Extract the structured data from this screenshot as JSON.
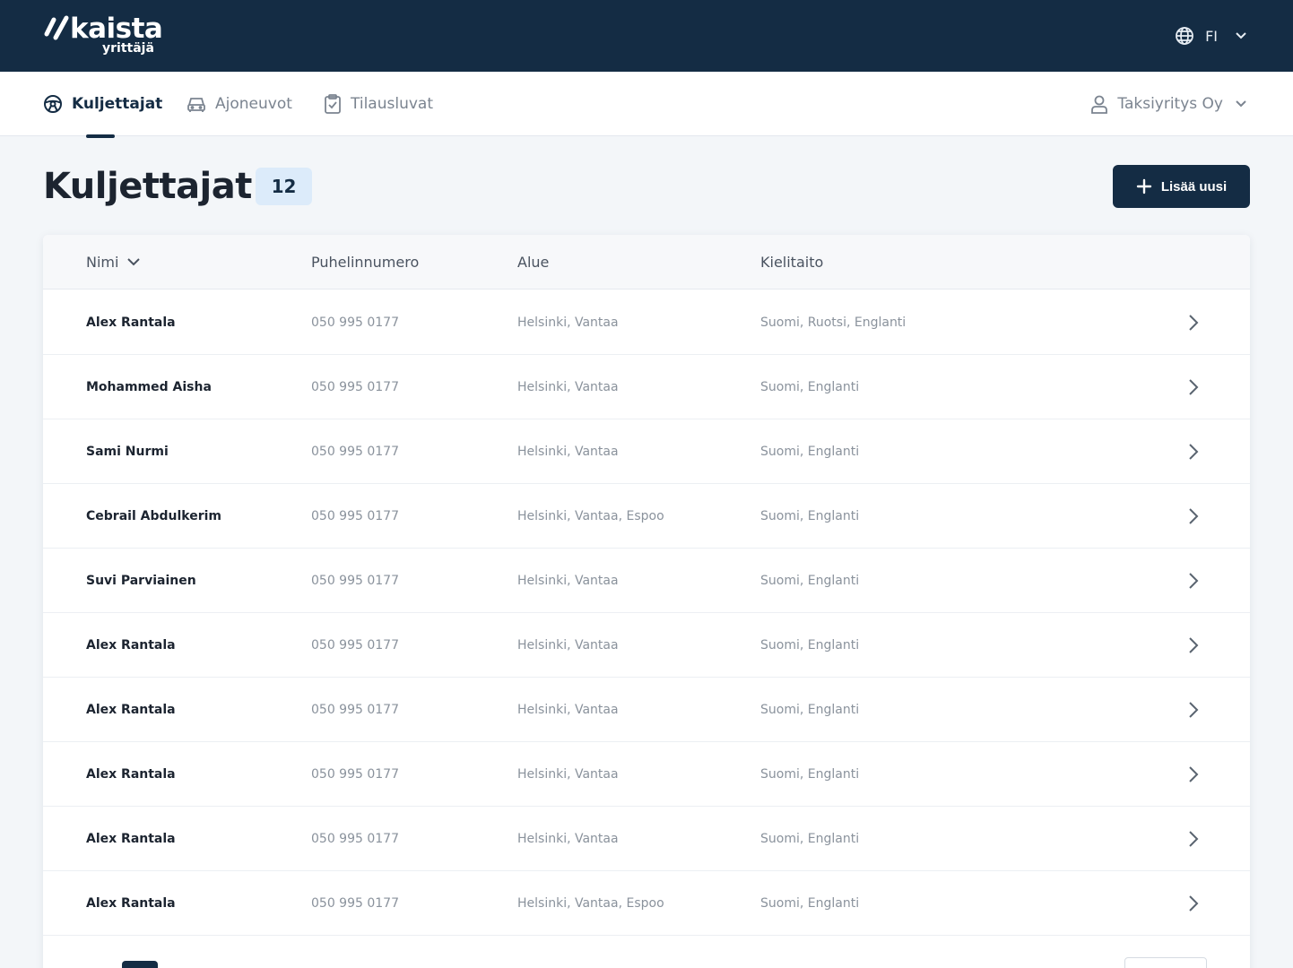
{
  "app": {
    "logo_main": "kaista",
    "logo_sub": "yrittäjä",
    "brand_color": "#142c44"
  },
  "language": {
    "label": "FI",
    "icon": "globe-icon"
  },
  "nav": {
    "items": [
      {
        "label": "Kuljettajat",
        "icon": "steering-wheel-icon",
        "active": true
      },
      {
        "label": "Ajoneuvot",
        "icon": "car-icon",
        "active": false
      },
      {
        "label": "Tilausluvat",
        "icon": "clipboard-icon",
        "active": false
      }
    ],
    "company": {
      "label": "Taksiyritys Oy",
      "icon": "user-icon"
    }
  },
  "page": {
    "title": "Kuljettajat",
    "count": "12",
    "add_button_label": "Lisää uusi"
  },
  "table": {
    "columns": [
      "Nimi",
      "Puhelinnumero",
      "Alue",
      "Kielitaito"
    ],
    "rows": [
      {
        "name": "Alex Rantala",
        "phone": "050 995 0177",
        "area": "Helsinki, Vantaa",
        "languages": "Suomi, Ruotsi, Englanti"
      },
      {
        "name": "Mohammed Aisha",
        "phone": "050 995 0177",
        "area": "Helsinki, Vantaa",
        "languages": "Suomi, Englanti"
      },
      {
        "name": "Sami Nurmi",
        "phone": "050 995 0177",
        "area": "Helsinki, Vantaa",
        "languages": "Suomi, Englanti"
      },
      {
        "name": "Cebrail Abdulkerim",
        "phone": "050 995 0177",
        "area": "Helsinki, Vantaa, Espoo",
        "languages": "Suomi, Englanti"
      },
      {
        "name": "Suvi Parviainen",
        "phone": "050 995 0177",
        "area": "Helsinki, Vantaa",
        "languages": "Suomi, Englanti"
      },
      {
        "name": "Alex Rantala",
        "phone": "050 995 0177",
        "area": "Helsinki, Vantaa",
        "languages": "Suomi, Englanti"
      },
      {
        "name": "Alex Rantala",
        "phone": "050 995 0177",
        "area": "Helsinki, Vantaa",
        "languages": "Suomi, Englanti"
      },
      {
        "name": "Alex Rantala",
        "phone": "050 995 0177",
        "area": "Helsinki, Vantaa",
        "languages": "Suomi, Englanti"
      },
      {
        "name": "Alex Rantala",
        "phone": "050 995 0177",
        "area": "Helsinki, Vantaa",
        "languages": "Suomi, Englanti"
      },
      {
        "name": "Alex Rantala",
        "phone": "050 995 0177",
        "area": "Helsinki, Vantaa, Espoo",
        "languages": "Suomi, Englanti"
      }
    ]
  }
}
